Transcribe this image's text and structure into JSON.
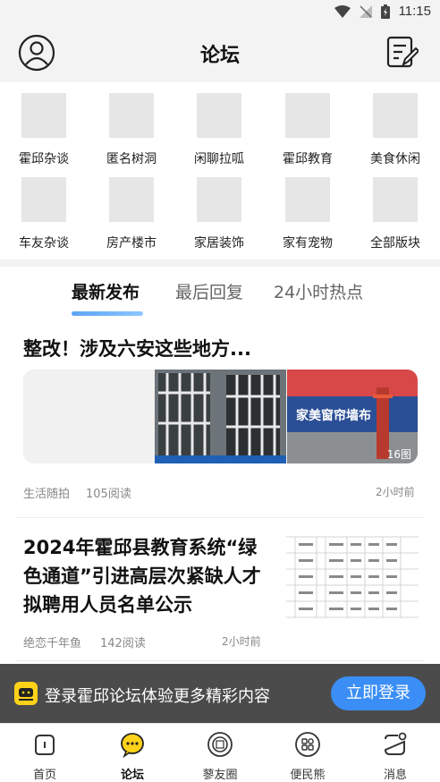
{
  "status": {
    "time": "11:15"
  },
  "header": {
    "title": "论坛"
  },
  "categories": [
    {
      "label": "霍邱杂谈"
    },
    {
      "label": "匿名树洞"
    },
    {
      "label": "闲聊拉呱"
    },
    {
      "label": "霍邱教育"
    },
    {
      "label": "美食休闲"
    },
    {
      "label": "车友杂谈"
    },
    {
      "label": "房产楼市"
    },
    {
      "label": "家居装饰"
    },
    {
      "label": "家有宠物"
    },
    {
      "label": "全部版块"
    }
  ],
  "tabs": [
    {
      "label": "最新发布"
    },
    {
      "label": "最后回复"
    },
    {
      "label": "24小时热点"
    }
  ],
  "posts": [
    {
      "title": "整改！涉及六安这些地方...",
      "section": "生活随拍",
      "reads": "105阅读",
      "time": "2小时前",
      "image_count": "16图",
      "sign_text": "家美窗帘墙布"
    },
    {
      "title": "2024年霍邱县教育系统“绿色通道”引进高层次紧缺人才拟聘用人员名单公示",
      "author": "绝恋千年鱼",
      "reads": "142阅读",
      "time": "2小时前"
    }
  ],
  "login_banner": {
    "text": "登录霍邱论坛体验更多精彩内容",
    "button": "立即登录"
  },
  "bottom_nav": [
    {
      "label": "首页",
      "icon": "home-icon"
    },
    {
      "label": "论坛",
      "icon": "chat-bubble-icon"
    },
    {
      "label": "蓼友圈",
      "icon": "circle-icon"
    },
    {
      "label": "便民熊",
      "icon": "grid-icon"
    },
    {
      "label": "消息",
      "icon": "message-icon"
    }
  ],
  "colors": {
    "accent": "#3a8ef5",
    "nav_active": "#ffd21a",
    "tab_underline": "#5da4f5"
  }
}
